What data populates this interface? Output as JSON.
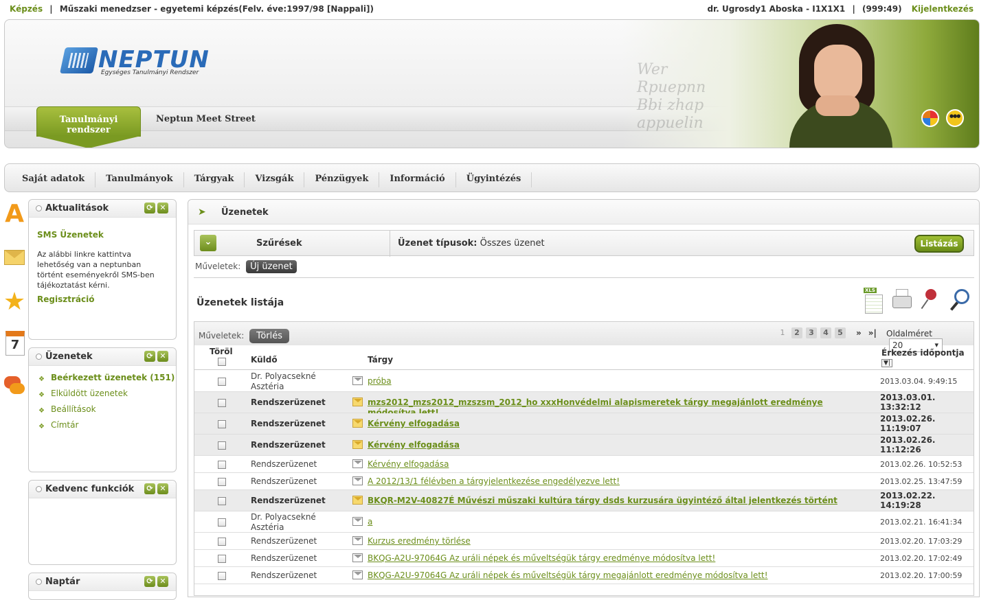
{
  "top": {
    "left_link": "Képzés",
    "program": "Műszaki menedzser - egyetemi képzés(Felv. éve:1997/98 [Nappali])",
    "user": "dr. Ugrosdy1 Aboska - I1X1X1",
    "timer": "(999:49)",
    "logout": "Kijelentkezés"
  },
  "header": {
    "logo_text": "NEPTUN",
    "logo_sub": "Egységes Tanulmányi Rendszer",
    "tab_active": "Tanulmányi rendszer",
    "tab_other": "Neptun Meet Street"
  },
  "menu": [
    "Saját adatok",
    "Tanulmányok",
    "Tárgyak",
    "Vizsgák",
    "Pénzügyek",
    "Információ",
    "Ügyintézés"
  ],
  "side": {
    "akt": {
      "title": "Aktualitások",
      "sms_title": "SMS Üzenetek",
      "sms_text": "Az alábbi linkre kattintva lehetőség van a neptunban történt eseményekről SMS-ben tájékoztatást kérni.",
      "reg": "Regisztráció"
    },
    "uz": {
      "title": "Üzenetek",
      "items": [
        "Beérkezett üzenetek (151)",
        "Elküldött üzenetek",
        "Beállítások",
        "Címtár"
      ]
    },
    "ked": {
      "title": "Kedvenc funkciók"
    },
    "nap": {
      "title": "Naptár"
    },
    "icon_cal_num": "7",
    "icon_a": "A"
  },
  "main": {
    "title": "Üzenetek",
    "filter_label": "Szűrések",
    "types_label": "Üzenet típusok:",
    "types_value": "Összes üzenet",
    "list_button": "Listázás",
    "ops_label": "Műveletek:",
    "new_msg": "Új üzenet",
    "list_title": "Üzenetek listája",
    "delete_btn": "Törlés",
    "pages": [
      "1",
      "2",
      "3",
      "4",
      "5"
    ],
    "page_size_label": "Oldalméret",
    "page_size": "20",
    "col_torol": "Töröl",
    "col_kuldo": "Küldő",
    "col_targy": "Tárgy",
    "col_erk": "Érkezés időpontja"
  },
  "messages": [
    {
      "from": "Dr. Polyacsekné Asztéria",
      "subject": "próba",
      "date": "2013.03.04. 9:49:15",
      "unread": false
    },
    {
      "from": "Rendszerüzenet",
      "subject": "mzs2012_mzs2012_mzszsm_2012_ho xxxHonvédelmi alapismeretek tárgy megajánlott eredménye módosítva lett!",
      "date": "2013.03.01. 13:32:12",
      "unread": true
    },
    {
      "from": "Rendszerüzenet",
      "subject": "Kérvény elfogadása",
      "date": "2013.02.26. 11:19:07",
      "unread": true
    },
    {
      "from": "Rendszerüzenet",
      "subject": "Kérvény elfogadása",
      "date": "2013.02.26. 11:12:26",
      "unread": true
    },
    {
      "from": "Rendszerüzenet",
      "subject": "Kérvény elfogadása",
      "date": "2013.02.26. 10:52:53",
      "unread": false
    },
    {
      "from": "Rendszerüzenet",
      "subject": "A 2012/13/1 félévben a tárgyjelentkezése engedélyezve lett!",
      "date": "2013.02.25. 13:47:59",
      "unread": false
    },
    {
      "from": "Rendszerüzenet",
      "subject": "BKQR-M2V-40827É Művészi műszaki kultúra tárgy dsds kurzusára ügyintéző által jelentkezés történt",
      "date": "2013.02.22. 14:19:28",
      "unread": true
    },
    {
      "from": "Dr. Polyacsekné Asztéria",
      "subject": "a",
      "date": "2013.02.21. 16:41:34",
      "unread": false
    },
    {
      "from": "Rendszerüzenet",
      "subject": "Kurzus eredmény törlése",
      "date": "2013.02.20. 17:03:29",
      "unread": false
    },
    {
      "from": "Rendszerüzenet",
      "subject": "BKQG-A2U-97064G Az uráli népek és műveltségük tárgy eredménye módosítva lett!",
      "date": "2013.02.20. 17:02:49",
      "unread": false
    },
    {
      "from": "Rendszerüzenet",
      "subject": "BKQG-A2U-97064G Az uráli népek és műveltségük tárgy megajánlott eredménye módosítva lett!",
      "date": "2013.02.20. 17:00:59",
      "unread": false
    }
  ]
}
